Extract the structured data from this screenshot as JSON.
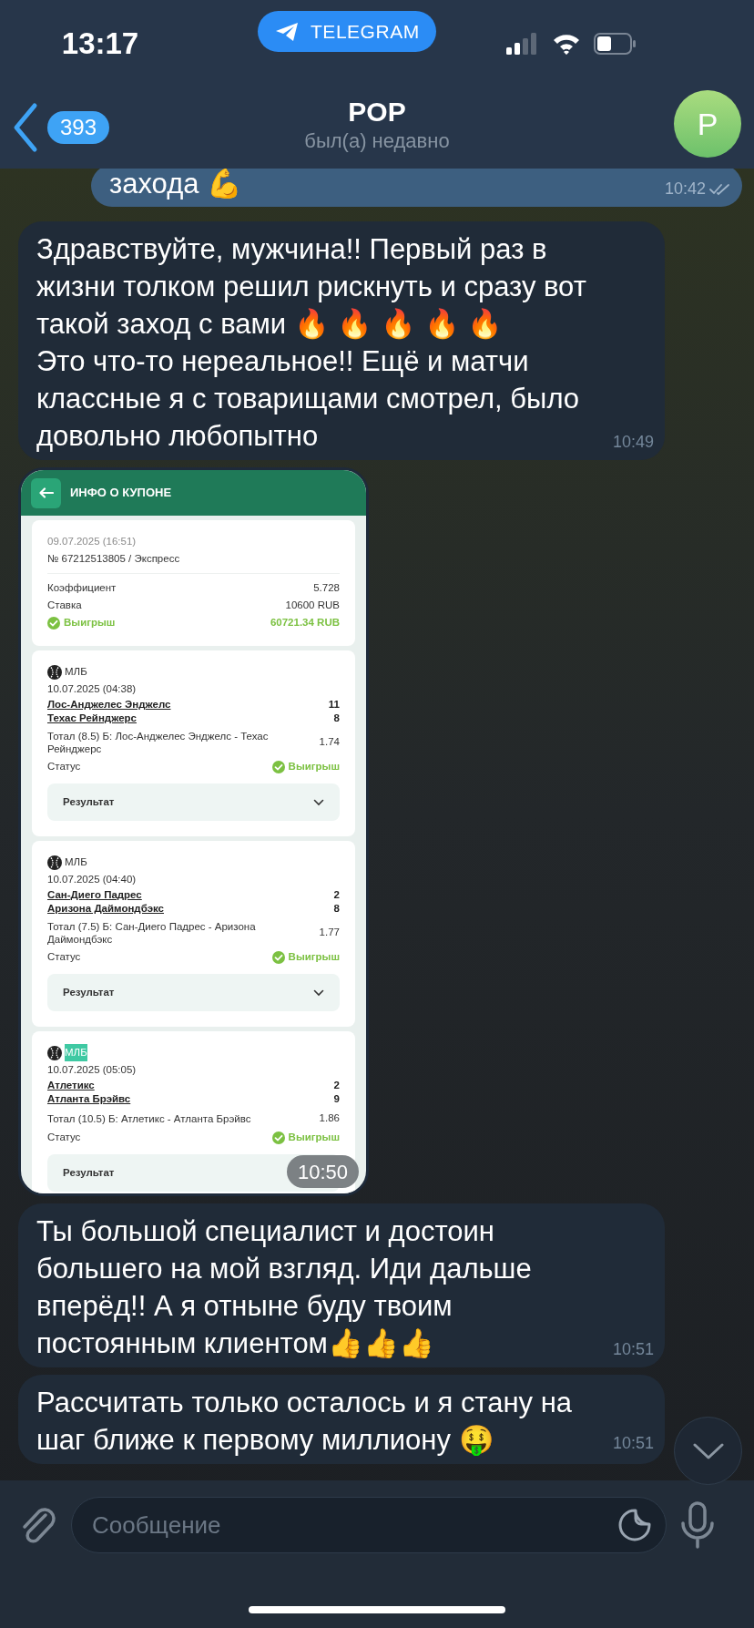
{
  "status_bar": {
    "time": "13:17",
    "app_pill": "TELEGRAM"
  },
  "header": {
    "back_count": "393",
    "title": "POP",
    "subtitle": "был(а) недавно",
    "avatar_letter": "P"
  },
  "messages": [
    {
      "kind": "text",
      "outgoing": true,
      "text": "захода 💪",
      "time": "10:42",
      "read": true
    },
    {
      "kind": "text",
      "outgoing": false,
      "text": "Здравствуйте, мужчина!! Первый раз в жизни толком решил рискнуть и сразу вот такой заход с вами 🔥 🔥 🔥 🔥 🔥\nЭто что-то нереальное!! Ещё и матчи классные я с товарищами смотрел, было довольно любопытно",
      "time": "10:49"
    },
    {
      "kind": "photo",
      "outgoing": false,
      "time": "10:50",
      "coupon": {
        "title": "ИНФО О КУПОНЕ",
        "date": "09.07.2025 (16:51)",
        "number": "№ 67212513805 / Экспресс",
        "rows": [
          {
            "label": "Коэффициент",
            "value": "5.728"
          },
          {
            "label": "Ставка",
            "value": "10600 RUB"
          }
        ],
        "result": {
          "label": "Выигрыш",
          "value": "60721.34 RUB",
          "won": true
        },
        "events": [
          {
            "league": "МЛБ",
            "highlighted": false,
            "date": "10.07.2025 (04:38)",
            "teams": [
              {
                "name": "Лос-Анджелес Энджелс",
                "score": "11"
              },
              {
                "name": "Техас Рейнджерс",
                "score": "8"
              }
            ],
            "bet": "Тотал (8.5) Б: Лос-Анджелес Энджелс - Техас Рейнджерс",
            "odds": "1.74",
            "status_label": "Статус",
            "status": "Выигрыш",
            "won": true,
            "result_label": "Результат"
          },
          {
            "league": "МЛБ",
            "highlighted": false,
            "date": "10.07.2025 (04:40)",
            "teams": [
              {
                "name": "Сан-Диего Падрес",
                "score": "2"
              },
              {
                "name": "Аризона Даймондбэкс",
                "score": "8"
              }
            ],
            "bet": "Тотал (7.5) Б: Сан-Диего Падрес - Аризона Даймондбэкс",
            "odds": "1.77",
            "status_label": "Статус",
            "status": "Выигрыш",
            "won": true,
            "result_label": "Результат"
          },
          {
            "league": "МЛБ",
            "highlighted": true,
            "date": "10.07.2025 (05:05)",
            "teams": [
              {
                "name": "Атлетикс",
                "score": "2"
              },
              {
                "name": "Атланта Брэйвс",
                "score": "9"
              }
            ],
            "bet": "Тотал (10.5) Б: Атлетикс - Атланта Брэйвс",
            "odds": "1.86",
            "status_label": "Статус",
            "status": "Выигрыш",
            "won": true,
            "result_label": "Результат"
          }
        ]
      }
    },
    {
      "kind": "text",
      "outgoing": false,
      "text": "Ты большой специалист и достоин большего на мой взгляд. Иди дальше вперёд!! А я отныне буду твоим постоянным клиентом👍👍👍",
      "time": "10:51"
    },
    {
      "kind": "text",
      "outgoing": false,
      "text": "Рассчитать только осталось и я стану на шаг ближе к первому миллиону 🤑",
      "time": "10:51"
    }
  ],
  "composer": {
    "placeholder": "Сообщение"
  }
}
